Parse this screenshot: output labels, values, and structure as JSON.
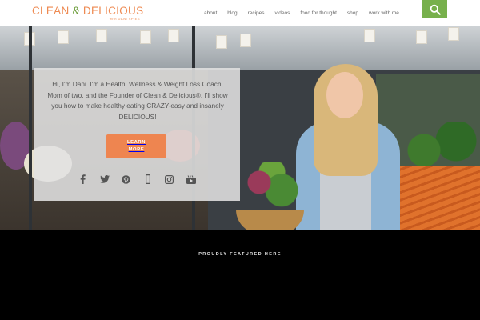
{
  "brand": {
    "logo_part1": "CLEAN",
    "logo_amp": " & ",
    "logo_part2": "DELICIOUS",
    "logo_tagline": "with DANI SPIES",
    "accent_orange": "#ee8550",
    "accent_green": "#77b04c"
  },
  "nav": {
    "items": [
      {
        "label": "about"
      },
      {
        "label": "blog"
      },
      {
        "label": "recipes"
      },
      {
        "label": "videos"
      },
      {
        "label": "food for thought"
      },
      {
        "label": "shop"
      },
      {
        "label": "work with me"
      }
    ],
    "search_icon": "search-icon"
  },
  "hero": {
    "intro": "Hi, I'm Dani. I'm a Health, Wellness & Weight Loss Coach, Mom of two, and the Founder of Clean & Delicious®. I'll show you how to make healthy eating CRAZY-easy and insanely DELICIOUS!",
    "cta_label": "LEARN MORE",
    "social_icons": [
      "facebook-icon",
      "twitter-icon",
      "pinterest-icon",
      "mobile-icon",
      "instagram-icon",
      "youtube-icon"
    ]
  },
  "featured": {
    "title": "PROUDLY FEATURED HERE"
  }
}
